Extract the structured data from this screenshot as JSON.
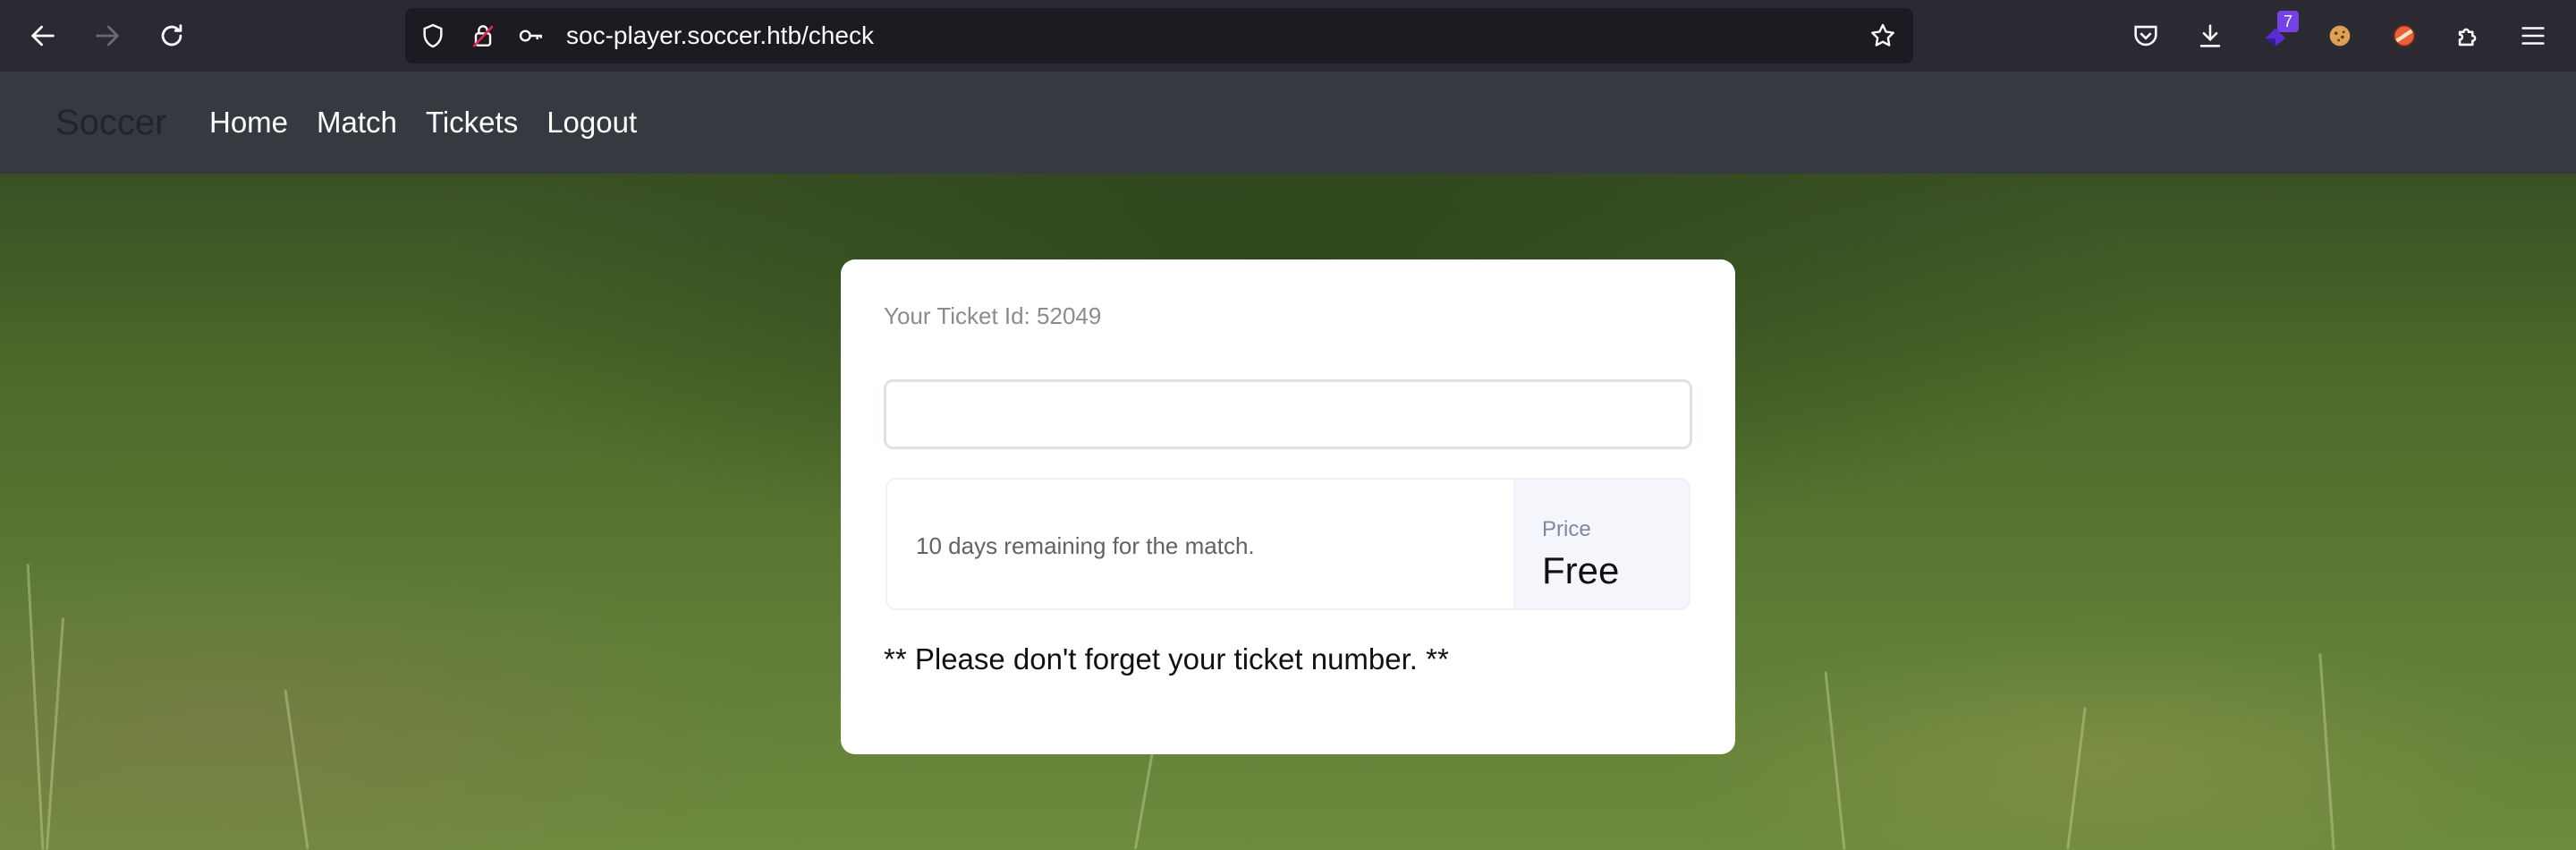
{
  "browser": {
    "url": "soc-player.soccer.htb/check",
    "extension_badge": "7",
    "icons": [
      "back-icon",
      "forward-icon",
      "reload-icon",
      "shield-icon",
      "insecure-lock-icon",
      "key-icon",
      "star-icon",
      "pocket-icon",
      "download-icon",
      "extension-badge-icon",
      "cookie-icon",
      "extension-icon",
      "puzzle-icon",
      "menu-icon"
    ]
  },
  "site": {
    "brand": "Soccer",
    "nav": {
      "home": "Home",
      "match": "Match",
      "tickets": "Tickets",
      "logout": "Logout"
    }
  },
  "ticket": {
    "id_label": "Your Ticket Id: 52049",
    "input_value": "",
    "remaining": "10 days remaining for the match.",
    "price_label": "Price",
    "price_value": "Free",
    "note": "** Please don't forget your ticket number. **"
  },
  "colors": {
    "toolbar": "#2b2a33",
    "navbar": "#343a40",
    "card": "#ffffff",
    "accent_badge": "#7542e5"
  }
}
